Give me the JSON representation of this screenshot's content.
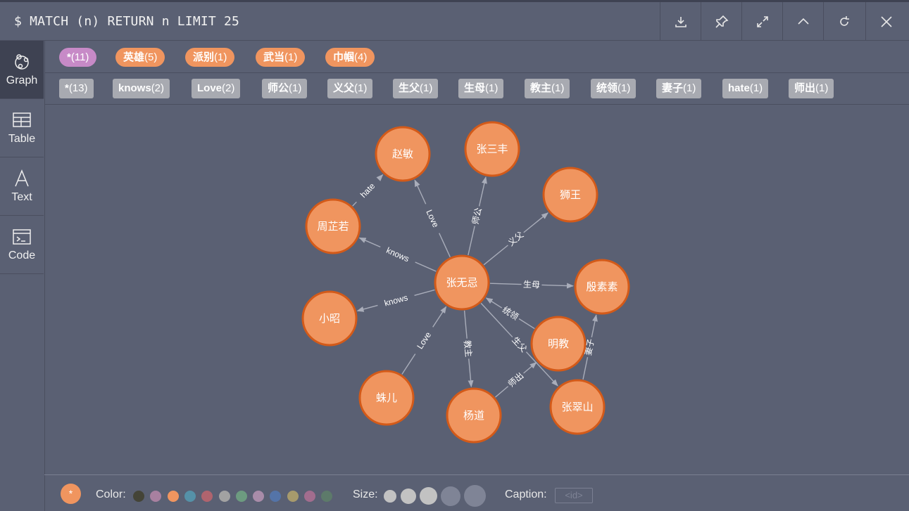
{
  "header": {
    "query": "$ MATCH (n) RETURN n LIMIT 25",
    "buttons": [
      "download-icon",
      "pin-icon",
      "expand-icon",
      "chevron-up-icon",
      "refresh-icon",
      "close-icon"
    ]
  },
  "sidebar": {
    "items": [
      {
        "label": "Graph",
        "icon": "graph-icon",
        "active": true
      },
      {
        "label": "Table",
        "icon": "table-icon",
        "active": false
      },
      {
        "label": "Text",
        "icon": "text-icon",
        "active": false
      },
      {
        "label": "Code",
        "icon": "code-icon",
        "active": false
      }
    ]
  },
  "node_labels": [
    {
      "name": "*",
      "count": "(11)"
    },
    {
      "name": "英雄",
      "count": "(5)"
    },
    {
      "name": "派别",
      "count": "(1)"
    },
    {
      "name": "武当",
      "count": "(1)"
    },
    {
      "name": "巾帼",
      "count": "(4)"
    }
  ],
  "rel_types": [
    {
      "name": "*",
      "count": "(13)"
    },
    {
      "name": "knows",
      "count": "(2)"
    },
    {
      "name": "Love",
      "count": "(2)"
    },
    {
      "name": "师公",
      "count": "(1)"
    },
    {
      "name": "义父",
      "count": "(1)"
    },
    {
      "name": "生父",
      "count": "(1)"
    },
    {
      "name": "生母",
      "count": "(1)"
    },
    {
      "name": "教主",
      "count": "(1)"
    },
    {
      "name": "统领",
      "count": "(1)"
    },
    {
      "name": "妻子",
      "count": "(1)"
    },
    {
      "name": "hate",
      "count": "(1)"
    },
    {
      "name": "师出",
      "count": "(1)"
    }
  ],
  "graph": {
    "nodes": [
      "赵敏",
      "张三丰",
      "狮王",
      "周芷若",
      "张无忌",
      "殷素素",
      "小昭",
      "明教",
      "蛛儿",
      "杨道",
      "张翠山"
    ],
    "edges": [
      {
        "label": "hate"
      },
      {
        "label": "Love"
      },
      {
        "label": "师公"
      },
      {
        "label": "义父"
      },
      {
        "label": "knows"
      },
      {
        "label": "生母"
      },
      {
        "label": "knows"
      },
      {
        "label": "统领"
      },
      {
        "label": "Love"
      },
      {
        "label": "教主"
      },
      {
        "label": "生父"
      },
      {
        "label": "师出"
      },
      {
        "label": "妻子"
      }
    ]
  },
  "footer": {
    "color_label": "Color:",
    "size_label": "Size:",
    "caption_label": "Caption:",
    "caption_value": "<id>",
    "selected_label": "*",
    "colors": [
      "#444437",
      "#a880a0",
      "#f0955f",
      "#5591a8",
      "#b0646e",
      "#a2a2a2",
      "#6d9b80",
      "#a98ca9",
      "#5474a8",
      "#a79a6c",
      "#a26d8e",
      "#5d7a6a"
    ]
  }
}
